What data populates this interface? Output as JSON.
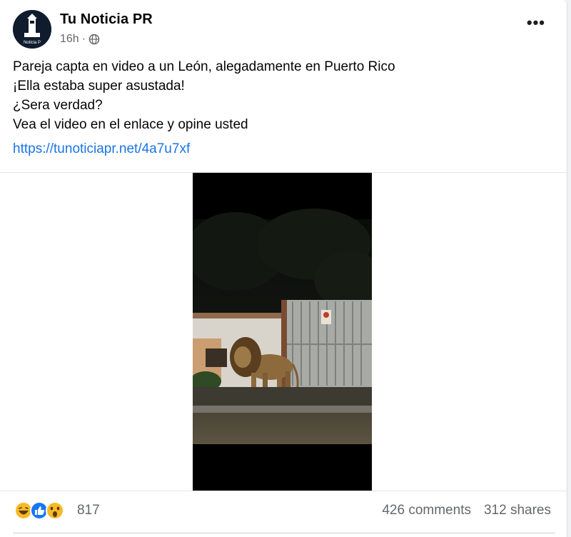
{
  "post": {
    "author": "Tu Noticia PR",
    "avatar_text": "Noticia P",
    "time": "16h",
    "visibility_icon": "globe-icon",
    "menu_icon": "more-options-icon",
    "lines": [
      "Pareja capta en video a un León, alegadamente en Puerto Rico",
      "¡Ella estaba super asustada!",
      "¿Sera verdad?",
      "Vea el video en el enlace y opine usted"
    ],
    "link": "https://tunoticiapr.net/4a7u7xf"
  },
  "media": {
    "type": "video-thumbnail",
    "subject": "lion-at-gate-night"
  },
  "engagement": {
    "reaction_icons": [
      "haha-icon",
      "like-icon",
      "wow-icon"
    ],
    "reaction_count": "817",
    "comments": "426 comments",
    "shares": "312 shares"
  },
  "colors": {
    "link": "#1b74e4",
    "like": "#1877f2",
    "emoji": "#f7b928",
    "muted": "#65676b"
  }
}
